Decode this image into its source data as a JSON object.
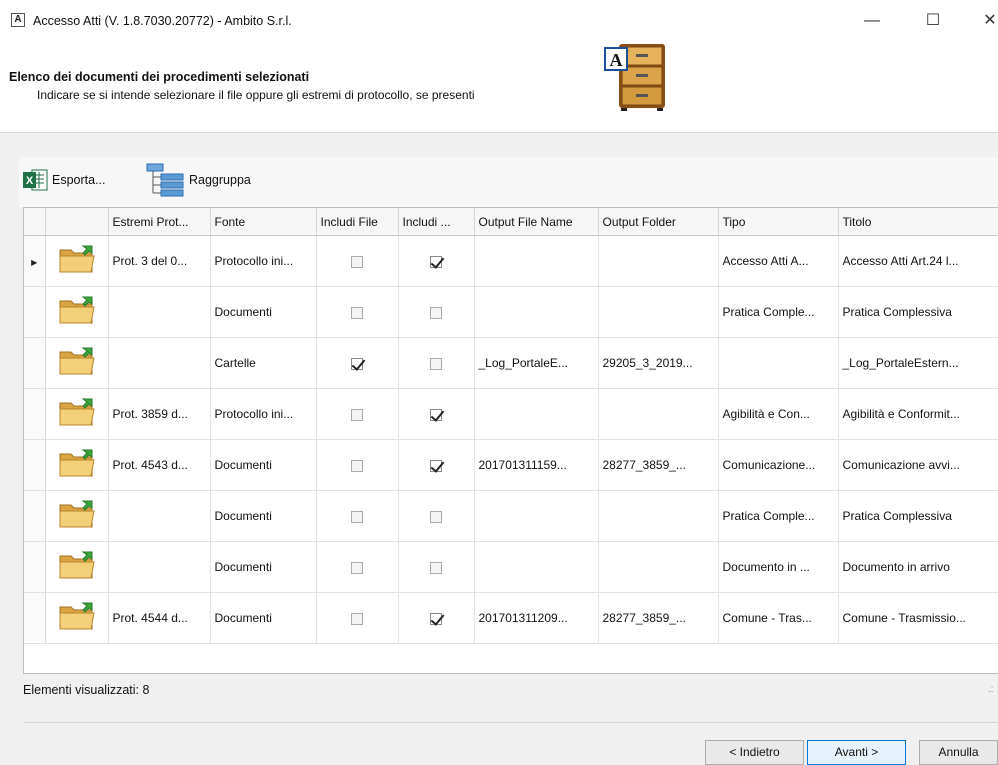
{
  "window": {
    "title": "Accesso Atti (V. 1.8.7030.20772) - Ambito S.r.l.",
    "app_icon_letter": "A",
    "minimize": "—",
    "maximize": "☐",
    "close": "✕"
  },
  "header": {
    "title": "Elenco dei documenti dei procedimenti selezionati",
    "subtitle": "Indicare se si intende selezionare il file oppure gli estremi di protocollo, se presenti",
    "logo_letter": "A"
  },
  "toolbar": {
    "export_label": "Esporta...",
    "group_label": "Raggruppa"
  },
  "grid": {
    "columns": [
      "Estremi Prot...",
      "Fonte",
      "Includi File",
      "Includi ...",
      "Output File Name",
      "Output Folder",
      "Tipo",
      "Titolo"
    ],
    "rows": [
      {
        "current": true,
        "estremi": "Prot. 3 del 0...",
        "fonte": "Protocollo ini...",
        "includi_file": false,
        "includi_prot": true,
        "output_file": "",
        "output_folder": "",
        "tipo": "Accesso Atti A...",
        "titolo": "Accesso Atti Art.24 l..."
      },
      {
        "current": false,
        "estremi": "",
        "fonte": "Documenti",
        "includi_file": false,
        "includi_prot": false,
        "output_file": "",
        "output_folder": "",
        "tipo": "Pratica Comple...",
        "titolo": "Pratica Complessiva"
      },
      {
        "current": false,
        "estremi": "",
        "fonte": "Cartelle",
        "includi_file": true,
        "includi_prot": false,
        "output_file": "_Log_PortaleE...",
        "output_folder": "29205_3_2019...",
        "tipo": "",
        "titolo": "_Log_PortaleEstern..."
      },
      {
        "current": false,
        "estremi": "Prot. 3859 d...",
        "fonte": "Protocollo ini...",
        "includi_file": false,
        "includi_prot": true,
        "output_file": "",
        "output_folder": "",
        "tipo": "Agibilità e Con...",
        "titolo": "Agibilità e Conformit..."
      },
      {
        "current": false,
        "estremi": "Prot. 4543 d...",
        "fonte": "Documenti",
        "includi_file": false,
        "includi_prot": true,
        "output_file": "201701311159...",
        "output_folder": "28277_3859_...",
        "tipo": "Comunicazione...",
        "titolo": "Comunicazione avvi..."
      },
      {
        "current": false,
        "estremi": "",
        "fonte": "Documenti",
        "includi_file": false,
        "includi_prot": false,
        "output_file": "",
        "output_folder": "",
        "tipo": "Pratica Comple...",
        "titolo": "Pratica Complessiva"
      },
      {
        "current": false,
        "estremi": "",
        "fonte": "Documenti",
        "includi_file": false,
        "includi_prot": false,
        "output_file": "",
        "output_folder": "",
        "tipo": "Documento in ...",
        "titolo": "Documento in arrivo"
      },
      {
        "current": false,
        "estremi": "Prot. 4544 d...",
        "fonte": "Documenti",
        "includi_file": false,
        "includi_prot": true,
        "output_file": "201701311209...",
        "output_folder": "28277_3859_...",
        "tipo": "Comune - Tras...",
        "titolo": "Comune - Trasmissio..."
      }
    ]
  },
  "status": {
    "text": "Elementi visualizzati: 8"
  },
  "buttons": {
    "back": "< Indietro",
    "next": "Avanti >",
    "cancel": "Annulla"
  }
}
